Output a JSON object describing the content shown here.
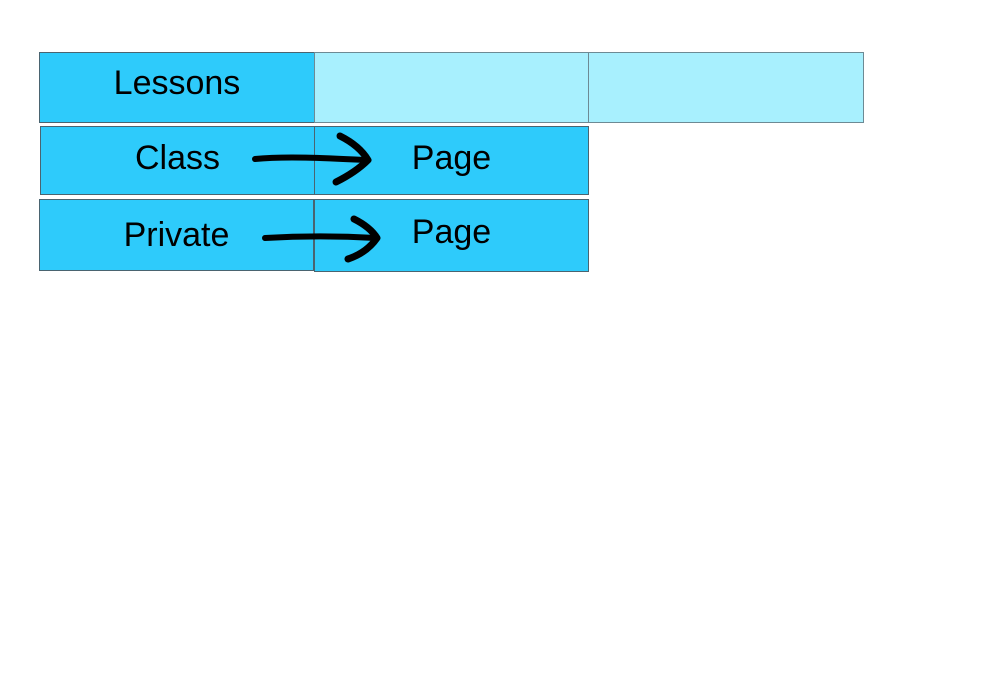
{
  "nodes": {
    "lessons": {
      "label": "Lessons"
    },
    "class": {
      "label": "Class"
    },
    "private": {
      "label": "Private"
    },
    "class_page": {
      "label": "Page"
    },
    "private_page": {
      "label": "Page"
    }
  },
  "edges": [
    {
      "from": "class",
      "to": "class_page"
    },
    {
      "from": "private",
      "to": "private_page"
    }
  ],
  "colors": {
    "box_fill": "#2ecbfb",
    "empty_box_fill": "#a8f0fe",
    "arrow": "#000000",
    "border": "#4a6470"
  }
}
